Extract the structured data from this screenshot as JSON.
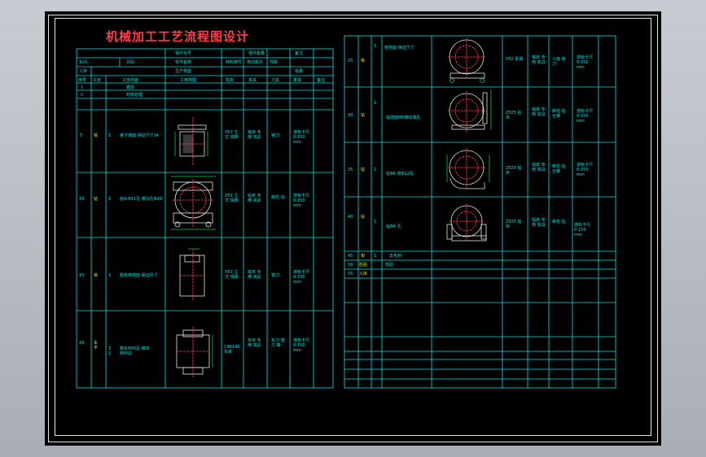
{
  "title": "机械加工工艺流程图设计",
  "colors": {
    "grid": "#00e5e5",
    "title": "#ff3b4a",
    "text_yellow": "#f0e000",
    "drawing": "#e8e8e8",
    "centerline": "#ff3b4a",
    "dim": "#00d040",
    "frame": "#e8e8e8",
    "background": "#000000"
  },
  "left_table": {
    "header": {
      "part_code_label": "零件代号",
      "part_quantity_label": "零件数量",
      "sheet_label": "页码",
      "part_name_label": "零件名称",
      "material_label": "材料牌号",
      "material_value": "电动机托",
      "quantity_label": "件数",
      "qty_value": "备注",
      "production_type_label": "生产类型",
      "batch_label": "批量",
      "factory_label": "材料",
      "row_labels": [
        "车间",
        "工序",
        "设备"
      ],
      "columns": [
        "序号",
        "工步",
        "工步内容",
        "工序简图",
        "夹具",
        "刀具",
        "机床",
        "量具",
        "辅具",
        "备注"
      ]
    },
    "rows": [
      {
        "no": "I",
        "step": "",
        "content": "铸造"
      },
      {
        "no": "II",
        "step": "",
        "content": "时效处理"
      },
      {
        "no": "5",
        "op": "铣",
        "step": "1.",
        "content": "铣下端面 保证尺寸14",
        "machine": "X51 立式 铣床",
        "fixture": "铣床 专用 夹具",
        "tool": "铣刀",
        "gauge": "游标卡尺 0-150 mm"
      },
      {
        "no": "10",
        "op": "钻",
        "step": "1.",
        "content": "钻4-Φ11孔 锪沉孔Φ20",
        "machine": "X51 立式 铣床",
        "fixture": "钻床 专用 夹具",
        "tool": "麻花 钻",
        "gauge": "游标卡尺 0-150 mm"
      },
      {
        "no": "15",
        "op": "铣",
        "step": "1.",
        "content": "粗铣两端面 保证尺寸",
        "machine": "X51 立式 铣床",
        "fixture": "铣床 专用 夹具",
        "tool": "铣刀",
        "gauge": "游标卡尺 0-150 mm"
      },
      {
        "no": "20",
        "op": "车 半",
        "step": "1. 2.",
        "content": "粗车Φ95孔 精车Φ95孔",
        "machine": "CA6140 车床",
        "fixture": "车床 专用 夹具",
        "tool": "车刀 镗刀 等",
        "gauge": "游标卡尺 0-150 mm"
      }
    ]
  },
  "right_table": {
    "rows": [
      {
        "no": "25",
        "op": "铣",
        "step": "1.",
        "content": "铣侧面 保证尺寸",
        "machine": "X62 卧铣",
        "fixture": "铣床 专用 夹具",
        "tool": "三面 铣刀",
        "gauge": "游标卡尺 0-150 mm"
      },
      {
        "no": "30",
        "op": "钻",
        "step": "1.",
        "content": "钻侧面M6螺纹底孔",
        "machine": "Z525 钻床",
        "fixture": "钻床 专用 夹具",
        "tool": "麻花 钻 丝锥",
        "gauge": "游标卡尺 0-150 mm"
      },
      {
        "no": "35",
        "op": "钻",
        "step": "1.",
        "content": "钻Φ6 锪Φ12孔",
        "machine": "Z525 钻床",
        "fixture": "钻床 专用 夹具",
        "tool": "麻花 钻 丝锥",
        "gauge": "游标卡尺 0-150 mm"
      },
      {
        "no": "40",
        "op": "钻",
        "step": "1.",
        "content": "钻Φ6 孔",
        "machine": "Z525 钻床",
        "fixture": "钻床 专用 夹具",
        "tool": "麻花 钻",
        "gauge": "游标卡尺 0-150 mm"
      },
      {
        "no": "45",
        "op": "钳",
        "step": "1.",
        "content": "去毛刺"
      },
      {
        "no": "50",
        "op": "检验",
        "content": "检验"
      },
      {
        "no": "55",
        "op": "入库",
        "content": ""
      }
    ]
  }
}
